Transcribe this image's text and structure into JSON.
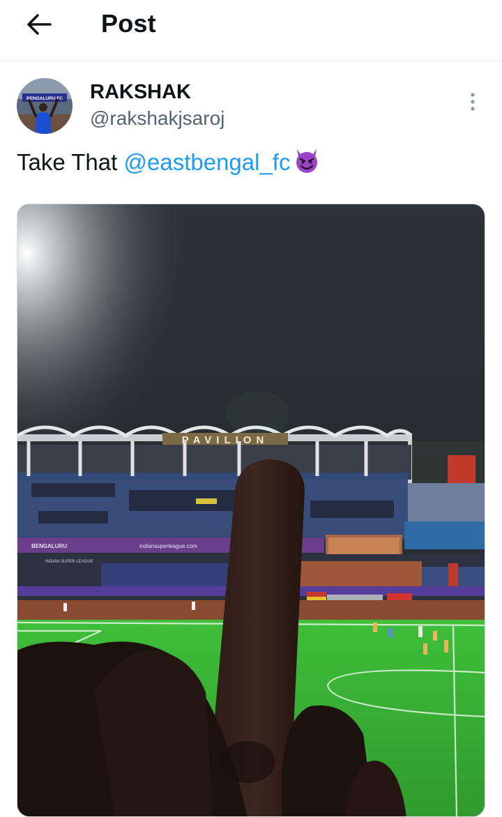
{
  "header": {
    "title": "Post",
    "back_icon": "arrow-left-icon"
  },
  "post": {
    "author": {
      "display_name": "RAKSHAK",
      "handle": "@rakshakjsaroj",
      "avatar_sign_text": "BENGALURU FC"
    },
    "text_prefix": "Take That ",
    "mention": "@eastbengal_fc",
    "emoji": "smiling-face-with-horns",
    "more_icon": "more-vertical-icon"
  },
  "media": {
    "stadium_sign": "PAVILION",
    "ad_board_1": "BENGALURU",
    "ad_board_2": "indiansuperleague.com",
    "league_board": "INDIAN SUPER LEAGUE"
  },
  "colors": {
    "text": "#0f1419",
    "secondary": "#536471",
    "accent": "#1d9bf0",
    "divider": "#e6e9ec"
  }
}
